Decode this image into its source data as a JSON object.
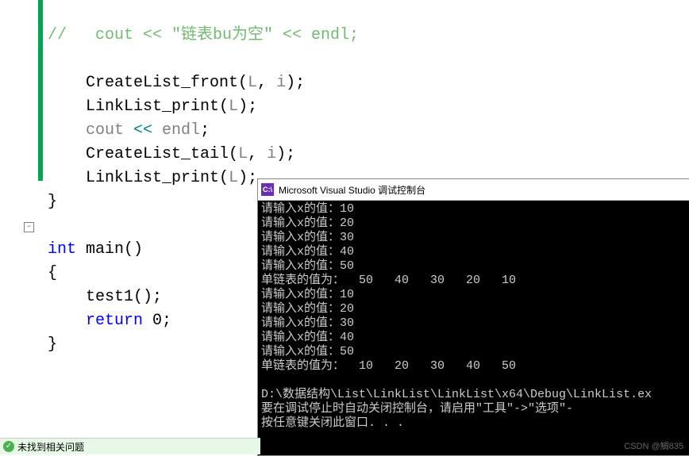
{
  "code": {
    "line1_comment": "//   cout << \"链表bu为空\" << endl;",
    "line2": "",
    "line3_a": "CreateList_front",
    "line3_b": "(",
    "line3_c": "L",
    "line3_d": ", ",
    "line3_e": "i",
    "line3_f": ");",
    "line4_a": "LinkList_print",
    "line4_b": "(",
    "line4_c": "L",
    "line4_d": ");",
    "line5_a": "cout",
    "line5_b": " << ",
    "line5_c": "endl",
    "line5_d": ";",
    "line6_a": "CreateList_tail",
    "line6_b": "(",
    "line6_c": "L",
    "line6_d": ", ",
    "line6_e": "i",
    "line6_f": ");",
    "line7_a": "LinkList_print",
    "line7_b": "(",
    "line7_c": "L",
    "line7_d": ");",
    "line8": "}",
    "line10_a": "int",
    "line10_b": " main()",
    "line11": "{",
    "line12_a": "test1",
    "line12_b": "();",
    "line13_a": "return",
    "line13_b": " 0;",
    "line14": "}"
  },
  "console": {
    "title": "Microsoft Visual Studio 调试控制台",
    "icon_text": "C:\\",
    "lines": [
      "请输入x的值：10",
      "请输入x的值：20",
      "请输入x的值：30",
      "请输入x的值：40",
      "请输入x的值：50",
      "单链表的值为：  50   40   30   20   10",
      "请输入x的值：10",
      "请输入x的值：20",
      "请输入x的值：30",
      "请输入x的值：40",
      "请输入x的值：50",
      "单链表的值为：  10   20   30   40   50",
      "",
      "D:\\数据结构\\List\\LinkList\\LinkList\\x64\\Debug\\LinkList.ex",
      "要在调试停止时自动关闭控制台，请启用\"工具\"->\"选项\"-",
      "按任意键关闭此窗口. . ."
    ],
    "watermark": "CSDN @鯛835"
  },
  "status": {
    "text": "未找到相关问题",
    "check": "✓"
  }
}
